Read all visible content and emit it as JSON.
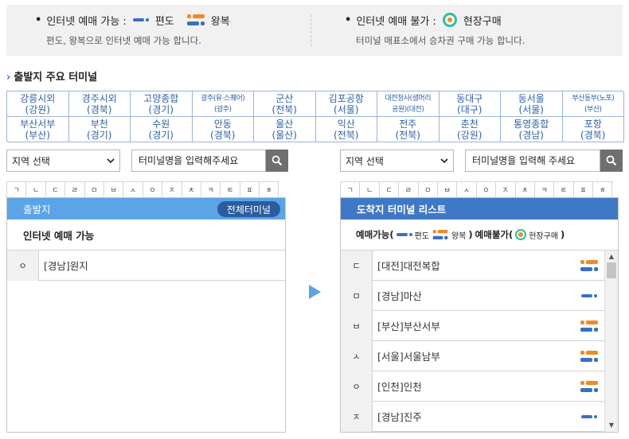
{
  "legend": {
    "bullet": "•",
    "online": {
      "label": "인터넷 예매 가능 :",
      "oneway": "편도",
      "roundtrip": "왕복",
      "desc": "편도, 왕복으로 인터넷 예매 가능 합니다."
    },
    "offline": {
      "label": "인터넷 예매 불가 :",
      "onsite": "현장구매",
      "desc": "터미널 매표소에서 승차권 구매 가능 합니다."
    }
  },
  "major": {
    "title": "출발지 주요 터미널",
    "chevron": "›",
    "terminals": [
      {
        "name": "강릉시외",
        "region": "(강원)",
        "small": false
      },
      {
        "name": "경주시외",
        "region": "(경북)",
        "small": false
      },
      {
        "name": "고양종합",
        "region": "(경기)",
        "small": false
      },
      {
        "name": "광주(유·스퀘어)",
        "region": "(광주)",
        "small": true
      },
      {
        "name": "군산",
        "region": "(전북)",
        "small": false
      },
      {
        "name": "김포공항",
        "region": "(서울)",
        "small": false
      },
      {
        "name": "대전청사(샘머리",
        "region": "공원)(대전)",
        "small": true
      },
      {
        "name": "동대구",
        "region": "(대구)",
        "small": false
      },
      {
        "name": "동서울",
        "region": "(서울)",
        "small": false
      },
      {
        "name": "부산동부(노포)",
        "region": "(부산)",
        "small": true
      },
      {
        "name": "부산서부",
        "region": "(부산)",
        "small": false
      },
      {
        "name": "부천",
        "region": "(경기)",
        "small": false
      },
      {
        "name": "수원",
        "region": "(경기)",
        "small": false
      },
      {
        "name": "안동",
        "region": "(경북)",
        "small": false
      },
      {
        "name": "울산",
        "region": "(울산)",
        "small": false
      },
      {
        "name": "익산",
        "region": "(전북)",
        "small": false
      },
      {
        "name": "전주",
        "region": "(전북)",
        "small": false
      },
      {
        "name": "춘천",
        "region": "(강원)",
        "small": false
      },
      {
        "name": "통영종합",
        "region": "(경남)",
        "small": false
      },
      {
        "name": "포항",
        "region": "(경북)",
        "small": false
      }
    ]
  },
  "departure": {
    "region_select": "지역 선택",
    "search_placeholder": "터미널명을 입력해주세요",
    "consonants": [
      "ㄱ",
      "ㄴ",
      "ㄷ",
      "ㄹ",
      "ㅁ",
      "ㅂ",
      "ㅅ",
      "ㅇ",
      "ㅈ",
      "ㅊ",
      "ㅋ",
      "ㅌ",
      "ㅍ",
      "ㅎ"
    ],
    "header": "출발지",
    "all_button": "전체터미널",
    "subheader": "인터넷 예매 가능",
    "rows": [
      {
        "cat": "ㅇ",
        "region": "[경남]",
        "name": "원지"
      }
    ]
  },
  "arrival": {
    "region_select": "지역 선택",
    "search_placeholder": "터미널명을 입력해 주세요",
    "consonants": [
      "ㄱ",
      "ㄴ",
      "ㄷ",
      "ㄹ",
      "ㅁ",
      "ㅂ",
      "ㅅ",
      "ㅇ",
      "ㅈ",
      "ㅊ",
      "ㅋ",
      "ㅌ",
      "ㅍ",
      "ㅎ"
    ],
    "header": "도착지 터미널 리스트",
    "legend": {
      "possible": "예매가능(",
      "oneway": "편도",
      "roundtrip": "왕복",
      "close_paren": ")",
      "impossible": "예매불가(",
      "onsite": "현장구매",
      "end_paren": ")"
    },
    "rows": [
      {
        "cat": "ㄷ",
        "region": "[대전]",
        "name": "대전복합",
        "type": "round"
      },
      {
        "cat": "ㅁ",
        "region": "[경남]",
        "name": "마산",
        "type": "oneway"
      },
      {
        "cat": "ㅂ",
        "region": "[부산]",
        "name": "부산서부",
        "type": "round"
      },
      {
        "cat": "ㅅ",
        "region": "[서울]",
        "name": "서울남부",
        "type": "round"
      },
      {
        "cat": "ㅇ",
        "region": "[인천]",
        "name": "인천",
        "type": "round"
      },
      {
        "cat": "ㅈ",
        "region": "[경남]",
        "name": "진주",
        "type": "oneway"
      }
    ]
  },
  "scroll": {
    "up": "▲",
    "down": "▼"
  },
  "colors": {
    "accent_blue": "#3a6fc1",
    "orange": "#f08a24",
    "teal": "#2bbfa4",
    "header_light": "#5ba4e6",
    "header_dark": "#3f78c6"
  }
}
